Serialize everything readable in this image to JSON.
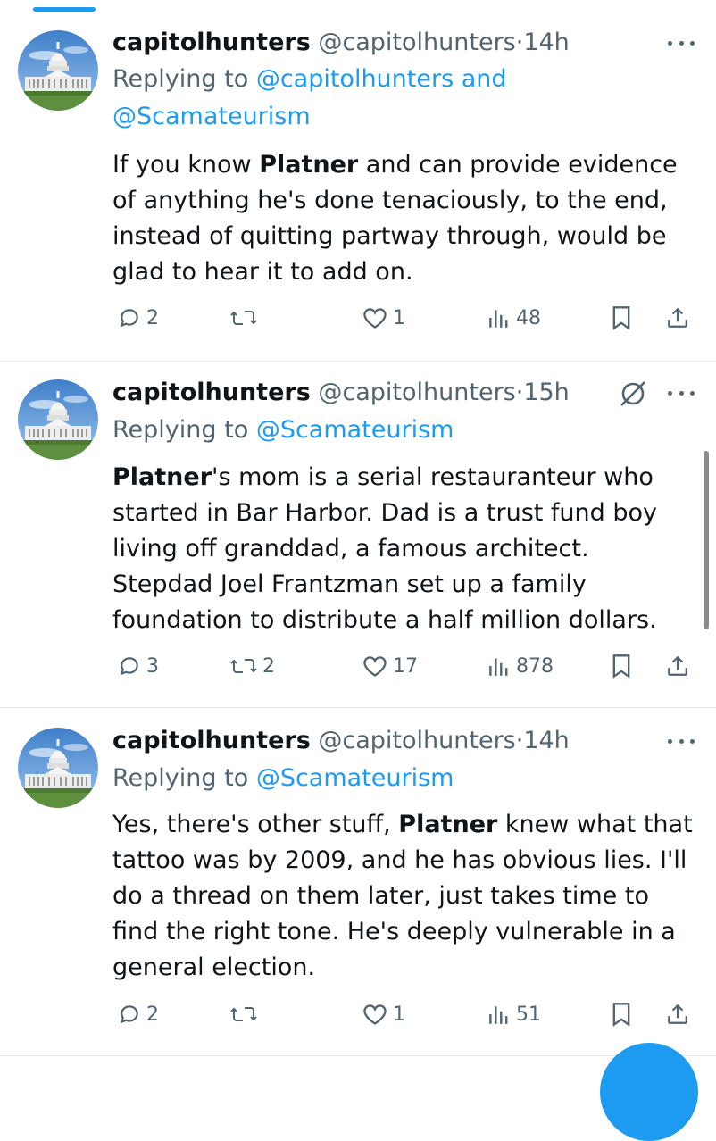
{
  "tweets": [
    {
      "name": "capitolhunters",
      "handle": "@capitolhunters",
      "dot": "·",
      "time": "14h",
      "reply_prefix": "Replying to",
      "mentions_line1": "@capitolhunters and",
      "mentions_line2": "@Scamateurism",
      "body": [
        {
          "bold": "",
          "text": "If you know "
        },
        {
          "bold": "Platner",
          "text": " and can provide evidence of anything he's done tenaciously, to the end, instead of quitting partway through, would be glad to hear it to add on."
        }
      ],
      "replies": "2",
      "retweets": "",
      "likes": "1",
      "views": "48"
    },
    {
      "name": "capitolhunters",
      "handle": "@capitolhunters",
      "dot": "·",
      "time": "15h",
      "reply_prefix": "Replying to",
      "mentions_line1": "@Scamateurism",
      "body_bold": "Platner",
      "body_rest": "'s mom is a serial restauranteur who started in Bar Harbor. Dad is a trust fund boy living off granddad, a famous architect. Stepdad Joel Frantzman set up a family foundation to distribute a half million dollars.",
      "replies": "3",
      "retweets": "2",
      "likes": "17",
      "views": "878"
    },
    {
      "name": "capitolhunters",
      "handle": "@capitolhunters",
      "dot": "·",
      "time": "14h",
      "reply_prefix": "Replying to",
      "mentions_line1": "@Scamateurism",
      "body_pre": "Yes, there's other stuff, ",
      "body_bold": "Platner",
      "body_rest": " knew what that tattoo was by 2009, and he has obvious lies. I'll do a thread on them later, just takes time to find the right tone. He's deeply vulnerable in a general election.",
      "replies": "2",
      "retweets": "",
      "likes": "1",
      "views": "51"
    }
  ],
  "icons": {
    "reply": "reply-icon",
    "retweet": "retweet-icon",
    "like": "heart-icon",
    "views": "views-icon",
    "bookmark": "bookmark-icon",
    "share": "share-icon",
    "more": "more-icon",
    "grok": "grok-icon"
  },
  "colors": {
    "accent": "#1d9bf0",
    "secondary_text": "#536471",
    "primary_text": "#0f1419"
  }
}
